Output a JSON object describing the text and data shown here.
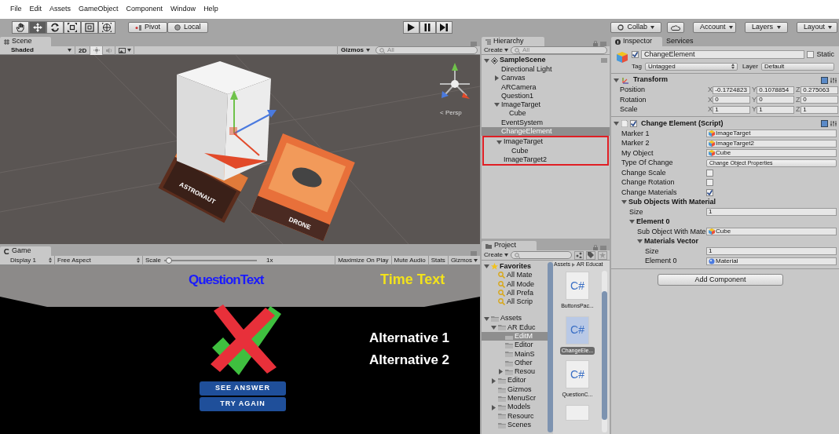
{
  "menu_bar": [
    "File",
    "Edit",
    "Assets",
    "GameObject",
    "Component",
    "Window",
    "Help"
  ],
  "toolbar": {
    "tools": [
      {
        "kind": "hand",
        "selected": false
      },
      {
        "kind": "move",
        "selected": true
      },
      {
        "kind": "rotate",
        "selected": false
      },
      {
        "kind": "scale",
        "selected": false
      },
      {
        "kind": "rect",
        "selected": false
      },
      {
        "kind": "transform",
        "selected": false
      }
    ],
    "pivot": "Pivot",
    "local": "Local",
    "playback": [
      {
        "kind": "play"
      },
      {
        "kind": "pause"
      },
      {
        "kind": "step"
      }
    ],
    "collab": "Collab",
    "account": "Account",
    "layers": "Layers",
    "layout": "Layout"
  },
  "scene": {
    "tab": "Scene",
    "shading": "Shaded",
    "mode_2d": "2D",
    "lighting": true,
    "audio": false,
    "gizmos": "Gizmos",
    "search_placeholder": "All",
    "view_label": "< Persp",
    "cards": [
      {
        "label": "ASTRONAUT"
      },
      {
        "label": "DRONE"
      }
    ]
  },
  "game": {
    "tab": "Game",
    "display": "Display 1",
    "aspect": "Free Aspect",
    "scale_label": "Scale",
    "scale": {
      "level": 0.02
    },
    "scale_value": "1x",
    "toggles": [
      "Maximize On Play",
      "Mute Audio",
      "Stats",
      "Gizmos"
    ],
    "question_text": "QuestionText",
    "time_text": "Time Text",
    "alternatives": [
      "Alternative 1",
      "Alternative 2"
    ],
    "buttons": [
      "SEE ANSWER",
      "TRY AGAIN"
    ]
  },
  "hierarchy": {
    "tab": "Hierarchy",
    "create": "Create",
    "search_placeholder": "All",
    "scene": "SampleScene",
    "items": [
      {
        "label": "Directional Light",
        "selected": false
      },
      {
        "label": "Canvas",
        "selected": false,
        "expanded": false
      },
      {
        "label": "ARCamera",
        "selected": false
      },
      {
        "label": "Question1",
        "selected": false
      },
      {
        "label": "ImageTarget",
        "selected": false,
        "expanded": true,
        "children": [
          {
            "label": "Cube",
            "selected": false
          }
        ]
      },
      {
        "label": "EventSystem",
        "selected": false
      },
      {
        "label": "ChangeElement",
        "selected": true
      },
      {
        "label": "ImageTarget",
        "selected": false,
        "highlighted": true,
        "expanded": true,
        "children": [
          {
            "label": "Cube",
            "selected": false
          }
        ]
      },
      {
        "label": "ImageTarget2",
        "selected": false,
        "highlighted": true
      }
    ]
  },
  "project": {
    "tab": "Project",
    "create": "Create",
    "breadcrumb": [
      "Assets",
      "AR Educat"
    ],
    "tree": [
      {
        "kind": "favorites",
        "label": "Favorites",
        "selected": false,
        "expanded": true,
        "children": [
          {
            "kind": "search",
            "label": "All Mate",
            "selected": false
          },
          {
            "kind": "search",
            "label": "All Mode",
            "selected": false
          },
          {
            "kind": "search",
            "label": "All Prefa",
            "selected": false
          },
          {
            "kind": "search",
            "label": "All Scrip",
            "selected": false
          }
        ]
      },
      {
        "kind": "folder",
        "label": "Assets",
        "selected": false,
        "expanded": true,
        "children": [
          {
            "kind": "folder",
            "label": "AR Educ",
            "selected": false,
            "expanded": true,
            "children": [
              {
                "kind": "folder",
                "label": "EditM",
                "selected": true
              },
              {
                "kind": "folder",
                "label": "Editor",
                "selected": false
              },
              {
                "kind": "folder",
                "label": "MainS",
                "selected": false
              },
              {
                "kind": "folder",
                "label": "Other",
                "selected": false
              },
              {
                "kind": "folder",
                "label": "Resou",
                "selected": false,
                "expanded": false
              }
            ]
          },
          {
            "kind": "folder",
            "label": "Editor",
            "selected": false,
            "expanded": false
          },
          {
            "kind": "folder",
            "label": "Gizmos",
            "selected": false
          },
          {
            "kind": "folder",
            "label": "MenuScr",
            "selected": false
          },
          {
            "kind": "folder",
            "label": "Models",
            "selected": false,
            "expanded": false
          },
          {
            "kind": "folder",
            "label": "Resourc",
            "selected": false
          },
          {
            "kind": "folder",
            "label": "Scenes",
            "selected": false
          }
        ]
      }
    ],
    "files": [
      {
        "icon_text": "C#",
        "label": "ButtonsPac...",
        "selected": false
      },
      {
        "icon_text": "C#",
        "label": "ChangeEle...",
        "selected": true
      },
      {
        "icon_text": "C#",
        "label": "QuestionC...",
        "selected": false
      }
    ]
  },
  "inspector": {
    "tabs": [
      {
        "label": "Inspector",
        "selected": true
      },
      {
        "label": "Services",
        "selected": false
      }
    ],
    "object": {
      "active": true,
      "name": "ChangeElement",
      "static_label": "Static",
      "static": false,
      "tag_label": "Tag",
      "tag": "Untagged",
      "layer_label": "Layer",
      "layer": "Default"
    },
    "transform": {
      "title": "Transform",
      "rows": [
        {
          "label": "Position",
          "values": [
            {
              "axis": "X",
              "value": "-0.1724823"
            },
            {
              "axis": "Y",
              "value": "0.1078854"
            },
            {
              "axis": "Z",
              "value": "0.275063"
            }
          ]
        },
        {
          "label": "Rotation",
          "values": [
            {
              "axis": "X",
              "value": "0"
            },
            {
              "axis": "Y",
              "value": "0"
            },
            {
              "axis": "Z",
              "value": "0"
            }
          ]
        },
        {
          "label": "Scale",
          "values": [
            {
              "axis": "X",
              "value": "1"
            },
            {
              "axis": "Y",
              "value": "1"
            },
            {
              "axis": "Z",
              "value": "1"
            }
          ]
        }
      ]
    },
    "script": {
      "enabled": true,
      "title": "Change Element (Script)",
      "fields": [
        {
          "kind": "gameobject",
          "label": "Marker 1",
          "value": "ImageTarget"
        },
        {
          "kind": "gameobject",
          "label": "Marker 2",
          "value": "ImageTarget2"
        },
        {
          "kind": "gameobject",
          "label": "My Object",
          "value": "Cube"
        },
        {
          "kind": "dropdown",
          "label": "Type Of Change",
          "value": "Change Object Properties"
        },
        {
          "kind": "checkbox",
          "label": "Change Scale",
          "checked": false
        },
        {
          "kind": "checkbox",
          "label": "Change Rotation",
          "checked": false
        },
        {
          "kind": "checkbox",
          "label": "Change Materials",
          "checked": true
        },
        {
          "kind": "foldout",
          "label": "Sub Objects With Material",
          "expanded": true,
          "children": [
            {
              "kind": "number",
              "label": "Size",
              "value": "1"
            },
            {
              "kind": "foldout",
              "label": "Element 0",
              "expanded": true,
              "children": [
                {
                  "kind": "gameobject",
                  "label": "Sub Object With Mate",
                  "value": "Cube"
                },
                {
                  "kind": "foldout",
                  "label": "Materials Vector",
                  "expanded": true,
                  "children": [
                    {
                      "kind": "number",
                      "label": "Size",
                      "value": "1"
                    },
                    {
                      "kind": "material",
                      "label": "Element 0",
                      "value": "Material"
                    }
                  ]
                }
              ]
            }
          ]
        }
      ]
    },
    "add_component": "Add Component"
  }
}
